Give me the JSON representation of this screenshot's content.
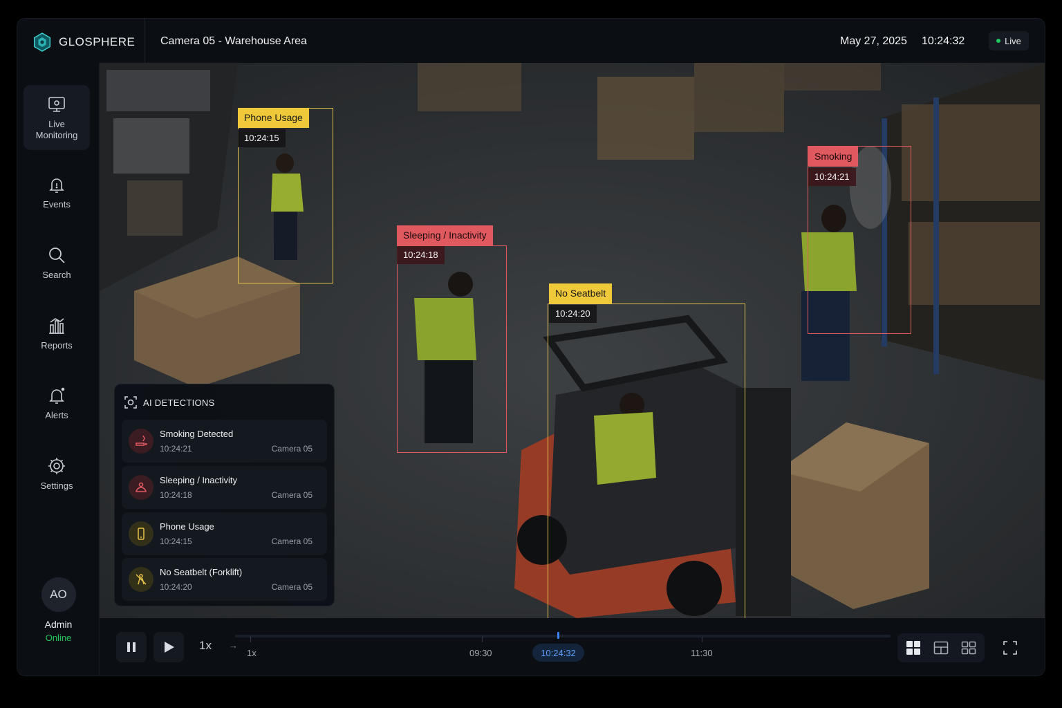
{
  "brand": {
    "name": "GLOSPHERE",
    "logo_icon": "hexagon-logo-icon"
  },
  "header": {
    "camera_title": "Camera 05 - Warehouse Area",
    "date": "May 27, 2025",
    "time": "10:24:32",
    "live_label": "Live"
  },
  "sidebar": {
    "items": [
      {
        "label": "Live\nMonitoring",
        "icon": "monitor-icon",
        "active": true
      },
      {
        "label": "Events",
        "icon": "bell-icon"
      },
      {
        "label": "Search",
        "icon": "search-icon"
      },
      {
        "label": "Reports",
        "icon": "chart-icon"
      },
      {
        "label": "Alerts",
        "icon": "alert-bell-icon"
      },
      {
        "label": "Settings",
        "icon": "gear-icon"
      }
    ],
    "user": {
      "initials": "AO",
      "name": "Admin",
      "status": "Online"
    }
  },
  "detections_overlay": [
    {
      "label": "Phone Usage",
      "time": "10:24:15",
      "color": "yellow"
    },
    {
      "label": "Sleeping / Inactivity",
      "time": "10:24:18",
      "color": "red"
    },
    {
      "label": "No Seatbelt",
      "time": "10:24:20",
      "color": "yellow"
    },
    {
      "label": "Smoking",
      "time": "10:24:21",
      "color": "red"
    }
  ],
  "panel": {
    "title": "AI DETECTIONS",
    "items": [
      {
        "title": "Smoking Detected",
        "time": "10:24:21",
        "camera": "Camera 05",
        "icon": "smoking-icon",
        "color": "#e35a60"
      },
      {
        "title": "Sleeping / Inactivity",
        "time": "10:24:18",
        "camera": "Camera 05",
        "icon": "sleeping-icon",
        "color": "#e35a60"
      },
      {
        "title": "Phone Usage",
        "time": "10:24:15",
        "camera": "Camera 05",
        "icon": "phone-icon",
        "color": "#e8c34b"
      },
      {
        "title": "No Seatbelt (Forklift)",
        "time": "10:24:20",
        "camera": "Camera 05",
        "icon": "seatbelt-icon",
        "color": "#e8c34b"
      }
    ]
  },
  "playback": {
    "speed_button": "1x",
    "speed_label": "1x",
    "ticks": [
      "09:30",
      "11:30"
    ],
    "current_time": "10:24:32"
  },
  "colors": {
    "accent": "#3b82f6",
    "live": "#22c55e",
    "yellow": "#e8c34b",
    "red": "#e35a60"
  }
}
